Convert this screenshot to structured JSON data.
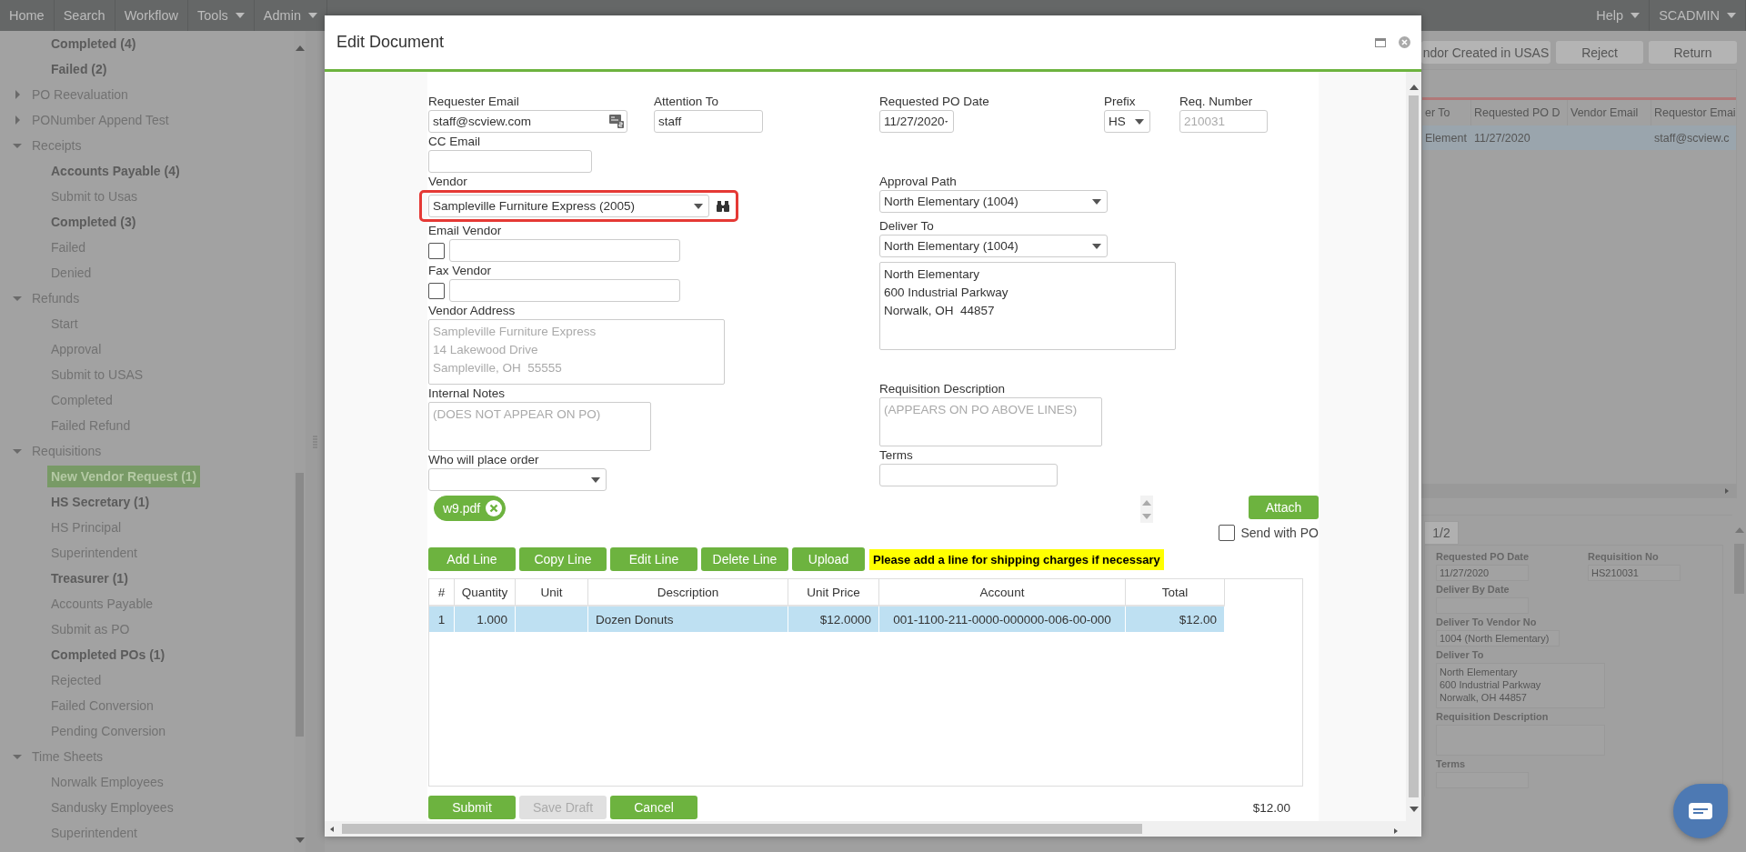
{
  "nav": {
    "items": [
      {
        "label": "Home",
        "dropdown": false
      },
      {
        "label": "Search",
        "dropdown": false
      },
      {
        "label": "Workflow",
        "dropdown": false
      },
      {
        "label": "Tools",
        "dropdown": true
      },
      {
        "label": "Admin",
        "dropdown": true
      }
    ],
    "right": [
      {
        "label": "Help",
        "dropdown": true
      },
      {
        "label": "SCADMIN",
        "dropdown": true
      }
    ]
  },
  "sidebar": {
    "partial_children": [
      {
        "label": "Completed (4)",
        "bold": true,
        "selected": false
      },
      {
        "label": "Failed (2)",
        "bold": true,
        "selected": false
      }
    ],
    "groups": [
      {
        "label": "PO Reevaluation",
        "expanded": false
      },
      {
        "label": "PONumber Append Test",
        "expanded": false
      },
      {
        "label": "Receipts",
        "expanded": true,
        "children": [
          {
            "label": "Accounts Payable (4)",
            "bold": true,
            "selected": false
          },
          {
            "label": "Submit to Usas",
            "bold": false,
            "selected": false
          },
          {
            "label": "Completed (3)",
            "bold": true,
            "selected": false
          },
          {
            "label": "Failed",
            "bold": false,
            "selected": false
          },
          {
            "label": "Denied",
            "bold": false,
            "selected": false
          }
        ]
      },
      {
        "label": "Refunds",
        "expanded": true,
        "children": [
          {
            "label": "Start",
            "bold": false,
            "selected": false
          },
          {
            "label": "Approval",
            "bold": false,
            "selected": false
          },
          {
            "label": "Submit to USAS",
            "bold": false,
            "selected": false
          },
          {
            "label": "Completed",
            "bold": false,
            "selected": false
          },
          {
            "label": "Failed Refund",
            "bold": false,
            "selected": false
          }
        ]
      },
      {
        "label": "Requisitions",
        "expanded": true,
        "children": [
          {
            "label": "New Vendor Request (1)",
            "bold": true,
            "selected": true
          },
          {
            "label": "HS Secretary (1)",
            "bold": true,
            "selected": false
          },
          {
            "label": "HS Principal",
            "bold": false,
            "selected": false
          },
          {
            "label": "Superintendent",
            "bold": false,
            "selected": false
          },
          {
            "label": "Treasurer (1)",
            "bold": true,
            "selected": false
          },
          {
            "label": "Accounts Payable",
            "bold": false,
            "selected": false
          },
          {
            "label": "Submit as PO",
            "bold": false,
            "selected": false
          },
          {
            "label": "Completed POs (1)",
            "bold": true,
            "selected": false
          },
          {
            "label": "Rejected",
            "bold": false,
            "selected": false
          },
          {
            "label": "Failed Conversion",
            "bold": false,
            "selected": false
          },
          {
            "label": "Pending Conversion",
            "bold": false,
            "selected": false
          }
        ]
      },
      {
        "label": "Time Sheets",
        "expanded": true,
        "children": [
          {
            "label": "Norwalk Employees",
            "bold": false,
            "selected": false
          },
          {
            "label": "Sandusky Employees",
            "bold": false,
            "selected": false
          },
          {
            "label": "Superintendent",
            "bold": false,
            "selected": false
          }
        ]
      }
    ]
  },
  "background": {
    "actions": [
      "ndor Created in USAS",
      "Reject",
      "Return"
    ],
    "grid": {
      "columns": [
        "er To",
        "Requested PO D",
        "Vendor Email",
        "Requestor Emai"
      ],
      "rows": [
        {
          "selected": true,
          "cells": [
            "Element",
            "11/27/2020",
            null,
            "staff@scview.c"
          ]
        }
      ]
    },
    "details": {
      "pager": "1/2",
      "fields": [
        {
          "label": "Requested PO Date",
          "value": "11/27/2020",
          "kind": "input"
        },
        {
          "label": "Requisition No",
          "value": "HS210031",
          "kind": "input"
        },
        {
          "label": "Deliver By Date",
          "kind": "input"
        },
        {
          "label": "Deliver To Vendor No",
          "value": "1004 (North Elementary)",
          "kind": "input"
        },
        {
          "label": "Deliver To",
          "value": "North Elementary\n600 Industrial Parkway\nNorwalk, OH 44857",
          "kind": "textarea"
        },
        {
          "label": "Requisition Description",
          "kind": "textarea"
        },
        {
          "label": "Terms",
          "kind": "input"
        }
      ]
    }
  },
  "modal": {
    "title": "Edit Document",
    "requester_email": {
      "label": "Requester Email",
      "value": "staff@scview.com"
    },
    "attention_to": {
      "label": "Attention To",
      "value": "staff"
    },
    "cc_email": {
      "label": "CC Email"
    },
    "vendor": {
      "label": "Vendor",
      "value": "Sampleville Furniture Express (2005)",
      "highlighted": true
    },
    "email_vendor": {
      "label": "Email Vendor",
      "checked": false
    },
    "fax_vendor": {
      "label": "Fax Vendor",
      "checked": false
    },
    "vendor_address": {
      "label": "Vendor Address",
      "value": "Sampleville Furniture Express\n14 Lakewood Drive\nSampleville, OH  55555",
      "disabled": true
    },
    "internal_notes": {
      "label": "Internal Notes",
      "placeholder": "(DOES NOT APPEAR ON PO)"
    },
    "who_will_place_order": {
      "label": "Who will place order"
    },
    "requested_po_date": {
      "label": "Requested PO Date",
      "value": "11/27/2020"
    },
    "prefix": {
      "label": "Prefix",
      "value": "HS"
    },
    "req_number": {
      "label": "Req. Number",
      "value": "210031",
      "disabled": true
    },
    "approval_path": {
      "label": "Approval Path",
      "value": "North Elementary (1004)"
    },
    "deliver_to": {
      "label": "Deliver To",
      "value": "North Elementary (1004)",
      "address": "North Elementary\n600 Industrial Parkway\nNorwalk, OH  44857"
    },
    "requisition_description": {
      "label": "Requisition Description",
      "placeholder": "(APPEARS ON PO ABOVE LINES)"
    },
    "terms": {
      "label": "Terms"
    },
    "attachments": [
      {
        "name": "w9.pdf"
      }
    ],
    "attach_button": "Attach",
    "send_with_po": {
      "label": "Send with PO",
      "checked": false
    },
    "line_buttons": [
      "Add Line",
      "Copy Line",
      "Edit Line",
      "Delete Line",
      "Upload"
    ],
    "notice": "Please add a line for shipping charges if necessary",
    "lines_table": {
      "columns": [
        "#",
        "Quantity",
        "Unit",
        "Description",
        "Unit Price",
        "Account",
        "Total"
      ],
      "rows": [
        {
          "selected": true,
          "cells": [
            "1",
            "1.000",
            null,
            "Dozen Donuts",
            "$12.0000",
            "001-1100-211-0000-000000-006-00-000",
            "$12.00"
          ]
        }
      ]
    },
    "footer_buttons": [
      {
        "label": "Submit",
        "disabled": false
      },
      {
        "label": "Save Draft",
        "disabled": true
      },
      {
        "label": "Cancel",
        "disabled": false
      }
    ],
    "total": "$12.00"
  }
}
